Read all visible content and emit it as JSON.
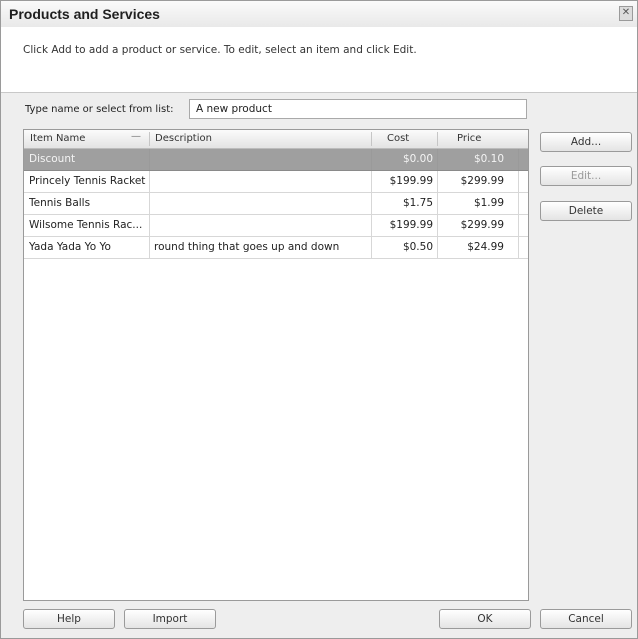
{
  "window": {
    "title": "Products and Services",
    "close_glyph": "✕"
  },
  "instructions": "Click Add to add a product or service. To edit, select an item and click Edit.",
  "filter": {
    "label": "Type name or select from list:",
    "value": "A new product"
  },
  "list": {
    "columns": {
      "item_name": "Item Name",
      "description": "Description",
      "cost": "Cost",
      "price": "Price"
    },
    "sort_indicator": "—",
    "rows": [
      {
        "name": "Discount",
        "description": "",
        "cost": "$0.00",
        "price": "$0.10",
        "selected": true
      },
      {
        "name": "Princely Tennis Racket",
        "description": "",
        "cost": "$199.99",
        "price": "$299.99"
      },
      {
        "name": "Tennis Balls",
        "description": "",
        "cost": "$1.75",
        "price": "$1.99"
      },
      {
        "name": "Wilsome Tennis Rac...",
        "description": "",
        "cost": "$199.99",
        "price": "$299.99"
      },
      {
        "name": "Yada Yada Yo Yo",
        "description": "round thing that goes up and down",
        "cost": "$0.50",
        "price": "$24.99"
      }
    ]
  },
  "side_buttons": {
    "add": "Add...",
    "edit": "Edit...",
    "delete": "Delete"
  },
  "bottom_buttons": {
    "help": "Help",
    "import": "Import",
    "ok": "OK",
    "cancel": "Cancel"
  }
}
